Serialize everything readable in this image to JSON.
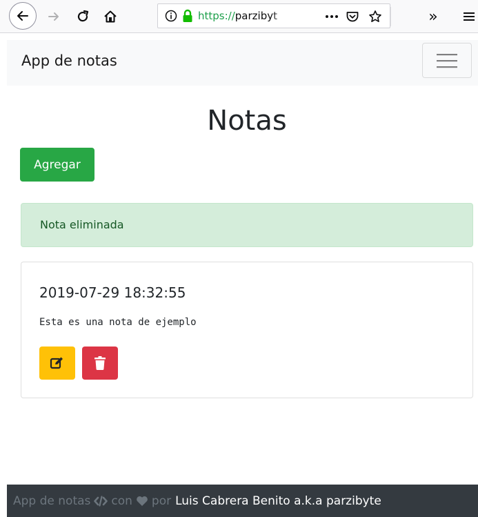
{
  "browser": {
    "url_prefix": "https://",
    "url_host": "parzibyt",
    "overflow_label": "»"
  },
  "navbar": {
    "brand": "App de notas",
    "toggler_icon": "hamburger-icon"
  },
  "page": {
    "title": "Notas",
    "add_button_label": "Agregar"
  },
  "alert": {
    "message": "Nota eliminada",
    "type": "success"
  },
  "notes": [
    {
      "date": "2019-07-29 18:32:55",
      "content": "Esta es una nota de ejemplo",
      "edit_icon": "edit-icon",
      "delete_icon": "trash-icon"
    }
  ],
  "footer": {
    "app_name": "App de notas",
    "con": "con",
    "por": "por",
    "author": "Luis Cabrera Benito a.k.a parzibyte"
  },
  "colors": {
    "success": "#28a745",
    "warning": "#ffc107",
    "danger": "#dc3545",
    "dark": "#343a40",
    "light": "#f8f9fa"
  }
}
